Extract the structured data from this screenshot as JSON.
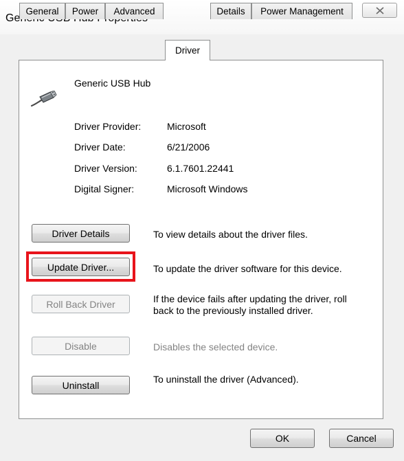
{
  "window": {
    "title": "Generic USB Hub Properties",
    "close_icon": "close-icon"
  },
  "tabs": [
    {
      "label": "General",
      "active": false
    },
    {
      "label": "Power",
      "active": false
    },
    {
      "label": "Advanced",
      "active": false
    },
    {
      "label": "Driver",
      "active": true
    },
    {
      "label": "Details",
      "active": false
    },
    {
      "label": "Power Management",
      "active": false
    }
  ],
  "device": {
    "name": "Generic USB Hub",
    "icon": "usb-plug-icon"
  },
  "driver_info": [
    {
      "label": "Driver Provider:",
      "value": "Microsoft"
    },
    {
      "label": "Driver Date:",
      "value": "6/21/2006"
    },
    {
      "label": "Driver Version:",
      "value": "6.1.7601.22441"
    },
    {
      "label": "Digital Signer:",
      "value": "Microsoft Windows"
    }
  ],
  "actions": [
    {
      "button": "Driver Details",
      "description": "To view details about the driver files.",
      "enabled": true,
      "highlighted": false
    },
    {
      "button": "Update Driver...",
      "description": "To update the driver software for this device.",
      "enabled": true,
      "highlighted": true
    },
    {
      "button": "Roll Back Driver",
      "description_line1": "If the device fails after updating the driver, roll",
      "description_line2": "back to the previously installed driver.",
      "enabled": false,
      "highlighted": false
    },
    {
      "button": "Disable",
      "description": "Disables the selected device.",
      "enabled": false,
      "highlighted": false
    },
    {
      "button": "Uninstall",
      "description": "To uninstall the driver (Advanced).",
      "enabled": true,
      "highlighted": false
    }
  ],
  "dialog_buttons": {
    "ok": "OK",
    "cancel": "Cancel"
  },
  "colors": {
    "highlight": "#e8141b",
    "disabled_text": "#838383"
  }
}
